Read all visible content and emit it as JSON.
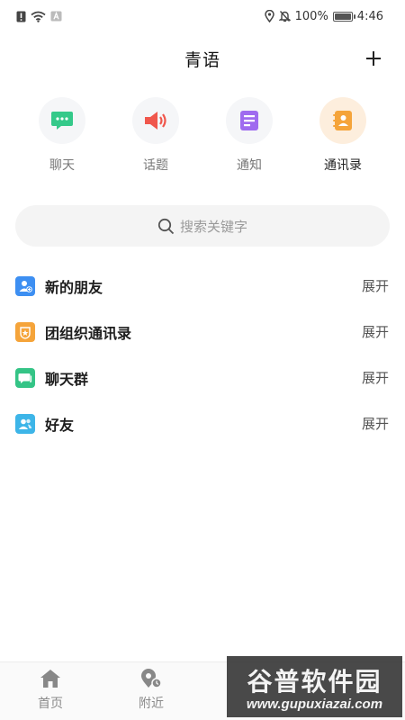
{
  "status_bar": {
    "battery_text": "100%",
    "battery_level": 1.0,
    "time": "4:46",
    "icons": [
      "alert-icon",
      "wifi-icon",
      "notification-a-icon",
      "location-icon",
      "mute-icon",
      "battery-icon"
    ]
  },
  "header": {
    "title": "青语",
    "add_icon": "plus-icon"
  },
  "quick_tabs": [
    {
      "label": "聊天",
      "icon": "chat-bubble-icon",
      "color": "#35c98a",
      "active": false
    },
    {
      "label": "话题",
      "icon": "speaker-icon",
      "color": "#f0574c",
      "active": false
    },
    {
      "label": "通知",
      "icon": "document-icon",
      "color": "#9f6bef",
      "active": false
    },
    {
      "label": "通讯录",
      "icon": "address-book-icon",
      "color": "#f5a43a",
      "active": true
    }
  ],
  "search": {
    "placeholder": "搜索关键字",
    "icon": "search-icon"
  },
  "groups": [
    {
      "label": "新的朋友",
      "action": "展开",
      "icon": "new-friend-icon",
      "color": "#3d8ff2"
    },
    {
      "label": "团组织通讯录",
      "action": "展开",
      "icon": "league-badge-icon",
      "color": "#f5a43a"
    },
    {
      "label": "聊天群",
      "action": "展开",
      "icon": "group-chat-icon",
      "color": "#34c486"
    },
    {
      "label": "好友",
      "action": "展开",
      "icon": "friend-icon",
      "color": "#3db5e8"
    }
  ],
  "bottom_nav": [
    {
      "label": "首页",
      "icon": "home-icon"
    },
    {
      "label": "附近",
      "icon": "nearby-icon"
    }
  ],
  "watermark": {
    "main": "谷普软件园",
    "sub": "www.gupuxiazai.com"
  }
}
